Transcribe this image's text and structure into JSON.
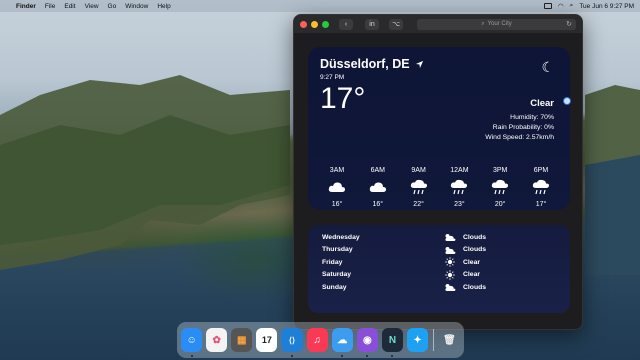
{
  "menubar": {
    "apple": "",
    "items": [
      "Finder",
      "File",
      "Edit",
      "View",
      "Go",
      "Window",
      "Help"
    ],
    "datetime": "Tue Jun 6  9:27 PM"
  },
  "window": {
    "address_placeholder": "Your City",
    "linkedin_label": "in",
    "github_label": "⌥"
  },
  "weather": {
    "city": "Düsseldorf, DE",
    "time": "9:27 PM",
    "temperature": "17°",
    "condition": "Clear",
    "humidity": "Humidity: 70%",
    "rain": "Rain Probability: 0%",
    "wind": "Wind Speed: 2.57km/h",
    "hourly": [
      {
        "hour": "3AM",
        "icon": "cloud-icon",
        "temp": "16°"
      },
      {
        "hour": "6AM",
        "icon": "cloud-icon",
        "temp": "16°"
      },
      {
        "hour": "9AM",
        "icon": "rain-cloud-icon",
        "temp": "22°"
      },
      {
        "hour": "12AM",
        "icon": "rain-cloud-icon",
        "temp": "23°"
      },
      {
        "hour": "3PM",
        "icon": "rain-cloud-icon",
        "temp": "20°"
      },
      {
        "hour": "6PM",
        "icon": "rain-cloud-icon",
        "temp": "17°"
      }
    ],
    "weekly": [
      {
        "day": "Wednesday",
        "icon": "cloud-sun-icon",
        "cond": "Clouds"
      },
      {
        "day": "Thursday",
        "icon": "cloud-sun-icon",
        "cond": "Clouds"
      },
      {
        "day": "Friday",
        "icon": "sun-icon",
        "cond": "Clear"
      },
      {
        "day": "Saturday",
        "icon": "sun-icon",
        "cond": "Clear"
      },
      {
        "day": "Sunday",
        "icon": "cloud-sun-icon",
        "cond": "Clouds"
      }
    ]
  },
  "dock": {
    "apps": [
      {
        "name": "finder",
        "label": "☺",
        "bg": "#2a8df5"
      },
      {
        "name": "photos",
        "label": "✿",
        "bg": "#f3f3f3"
      },
      {
        "name": "calculator",
        "label": "▦",
        "bg": "#555555"
      },
      {
        "name": "calendar",
        "label": "17",
        "bg": "#ffffff"
      },
      {
        "name": "vscode",
        "label": "⟨⟩",
        "bg": "#1f7fd6"
      },
      {
        "name": "music",
        "label": "♫",
        "bg": "#fa3a55"
      },
      {
        "name": "weather",
        "label": "☁",
        "bg": "#3b9cf0"
      },
      {
        "name": "github-desktop",
        "label": "◉",
        "bg": "#8a4fd8"
      },
      {
        "name": "notion",
        "label": "N",
        "bg": "#1e2a3a"
      },
      {
        "name": "twitter",
        "label": "✦",
        "bg": "#1da1f2"
      },
      {
        "name": "trash",
        "label": "🗑",
        "bg": "transparent"
      }
    ]
  }
}
